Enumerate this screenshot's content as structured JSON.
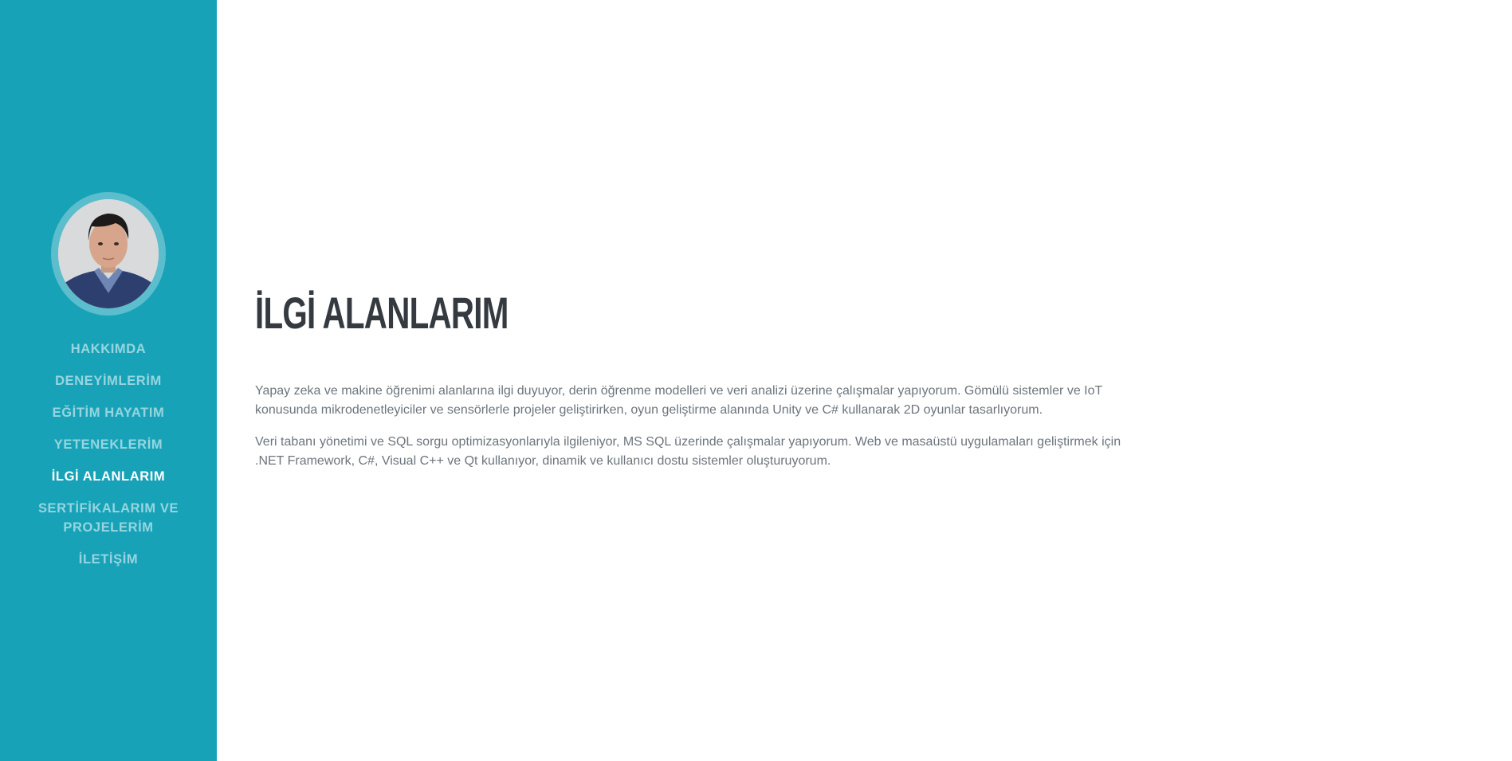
{
  "sidebar": {
    "background": "#17a2b8",
    "avatar_alt": "profile photo",
    "nav": [
      {
        "label": "HAKKIMDA",
        "active": false
      },
      {
        "label": "DENEYİMLERİM",
        "active": false
      },
      {
        "label": "EĞİTİM HAYATIM",
        "active": false
      },
      {
        "label": "YETENEKLERİM",
        "active": false
      },
      {
        "label": "İLGİ ALANLARIM",
        "active": true
      },
      {
        "label": "SERTİFİKALARIM VE PROJELERİM",
        "active": false
      },
      {
        "label": "İLETİŞİM",
        "active": false
      }
    ]
  },
  "main": {
    "title": "İLGİ ALANLARIM",
    "paragraphs": [
      "Yapay zeka ve makine öğrenimi alanlarına ilgi duyuyor, derin öğrenme modelleri ve veri analizi üzerine çalışmalar yapıyorum. Gömülü sistemler ve IoT konusunda mikrodenetleyiciler ve sensörlerle projeler geliştirirken, oyun geliştirme alanında Unity ve C# kullanarak 2D oyunlar tasarlıyorum.",
      "Veri tabanı yönetimi ve SQL sorgu optimizasyonlarıyla ilgileniyor, MS SQL üzerinde çalışmalar yapıyorum. Web ve masaüstü uygulamaları geliştirmek için .NET Framework, C#, Visual C++ ve Qt kullanıyor, dinamik ve kullanıcı dostu sistemler oluşturuyorum."
    ]
  }
}
